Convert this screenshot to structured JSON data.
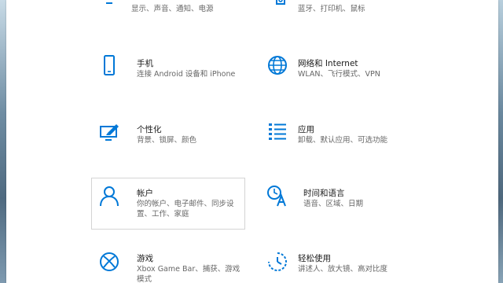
{
  "accent_color": "#0078d7",
  "tiles": [
    {
      "icon": "display-icon",
      "title": "",
      "desc": "显示、声音、通知、电源"
    },
    {
      "icon": "devices-icon",
      "title": "",
      "desc": "蓝牙、打印机、鼠标"
    },
    {
      "icon": "phone-icon",
      "title": "手机",
      "desc": "连接 Android 设备和 iPhone"
    },
    {
      "icon": "globe-icon",
      "title": "网络和 Internet",
      "desc": "WLAN、飞行模式、VPN"
    },
    {
      "icon": "personalization-icon",
      "title": "个性化",
      "desc": "背景、锁屏、颜色"
    },
    {
      "icon": "apps-list-icon",
      "title": "应用",
      "desc": "卸载、默认应用、可选功能"
    },
    {
      "icon": "person-icon",
      "title": "帐户",
      "desc_lines": [
        "你的帐户、电子邮件、同步设",
        "置、工作、家庭"
      ]
    },
    {
      "icon": "time-language-icon",
      "title": "时间和语言",
      "desc": "语音、区域、日期"
    },
    {
      "icon": "xbox-icon",
      "title": "游戏",
      "desc_lines": [
        "Xbox Game Bar、捕获、游戏",
        "模式"
      ]
    },
    {
      "icon": "ease-of-access-icon",
      "title": "轻松使用",
      "desc": "讲述人、放大镜、高对比度"
    }
  ]
}
